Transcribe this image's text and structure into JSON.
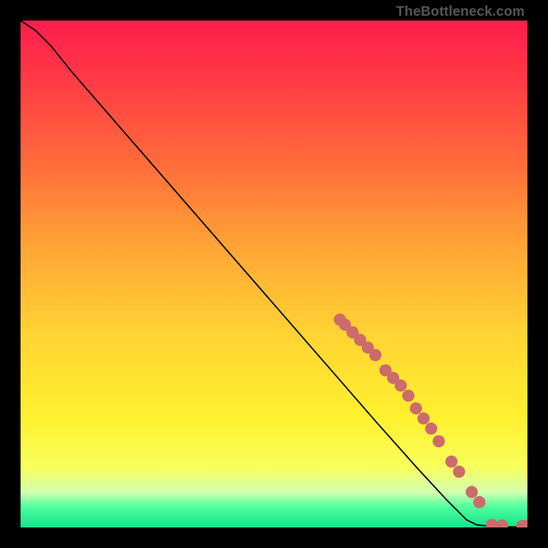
{
  "watermark": "TheBottleneck.com",
  "chart_data": {
    "type": "line",
    "title": "",
    "xlabel": "",
    "ylabel": "",
    "xlim": [
      0,
      100
    ],
    "ylim": [
      0,
      100
    ],
    "grid": false,
    "legend": false,
    "series": [
      {
        "name": "curve",
        "x": [
          0,
          3,
          6,
          10,
          20,
          30,
          40,
          50,
          60,
          70,
          78,
          84,
          88,
          90,
          93,
          96,
          100
        ],
        "y": [
          100,
          98,
          95,
          90,
          78.5,
          67,
          55.5,
          44,
          32.5,
          21,
          12,
          5.5,
          1.5,
          0.5,
          0.2,
          0.1,
          0.1
        ],
        "color": "#000000",
        "linewidth": 2
      }
    ],
    "markers": {
      "name": "dots",
      "color": "#cc6b6b",
      "radius_pct": 1.2,
      "points": [
        {
          "x": 63,
          "y": 41
        },
        {
          "x": 64,
          "y": 40
        },
        {
          "x": 65.5,
          "y": 38.5
        },
        {
          "x": 67,
          "y": 37
        },
        {
          "x": 68.5,
          "y": 35.5
        },
        {
          "x": 70,
          "y": 34
        },
        {
          "x": 72,
          "y": 31
        },
        {
          "x": 73.5,
          "y": 29.5
        },
        {
          "x": 75,
          "y": 28
        },
        {
          "x": 76.5,
          "y": 26
        },
        {
          "x": 78,
          "y": 23.5
        },
        {
          "x": 79.5,
          "y": 21.5
        },
        {
          "x": 81,
          "y": 19.5
        },
        {
          "x": 82.5,
          "y": 17
        },
        {
          "x": 85,
          "y": 13
        },
        {
          "x": 86.5,
          "y": 11
        },
        {
          "x": 89,
          "y": 7
        },
        {
          "x": 90.5,
          "y": 5
        },
        {
          "x": 93,
          "y": 0.5
        },
        {
          "x": 95,
          "y": 0.4
        },
        {
          "x": 99,
          "y": 0.3
        },
        {
          "x": 100,
          "y": 0.3
        }
      ]
    }
  }
}
